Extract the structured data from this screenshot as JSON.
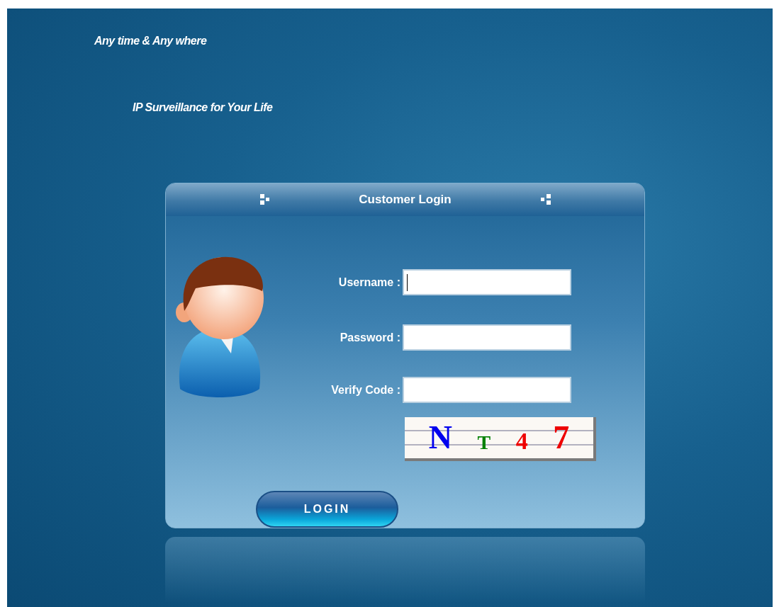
{
  "taglines": [
    "Any time & Any where",
    "IP Surveillance for Your Life"
  ],
  "login": {
    "title": "Customer Login",
    "fields": [
      {
        "label": "Username :",
        "focused": true
      },
      {
        "label": "Password :",
        "focused": false
      },
      {
        "label": "Verify Code :",
        "focused": false
      }
    ],
    "captcha": [
      {
        "char": "N",
        "color": "#0000ee"
      },
      {
        "char": "T",
        "color": "#008000"
      },
      {
        "char": "4",
        "color": "#ee0000"
      },
      {
        "char": "7",
        "color": "#ee0000"
      }
    ],
    "button": "LOGIN"
  }
}
